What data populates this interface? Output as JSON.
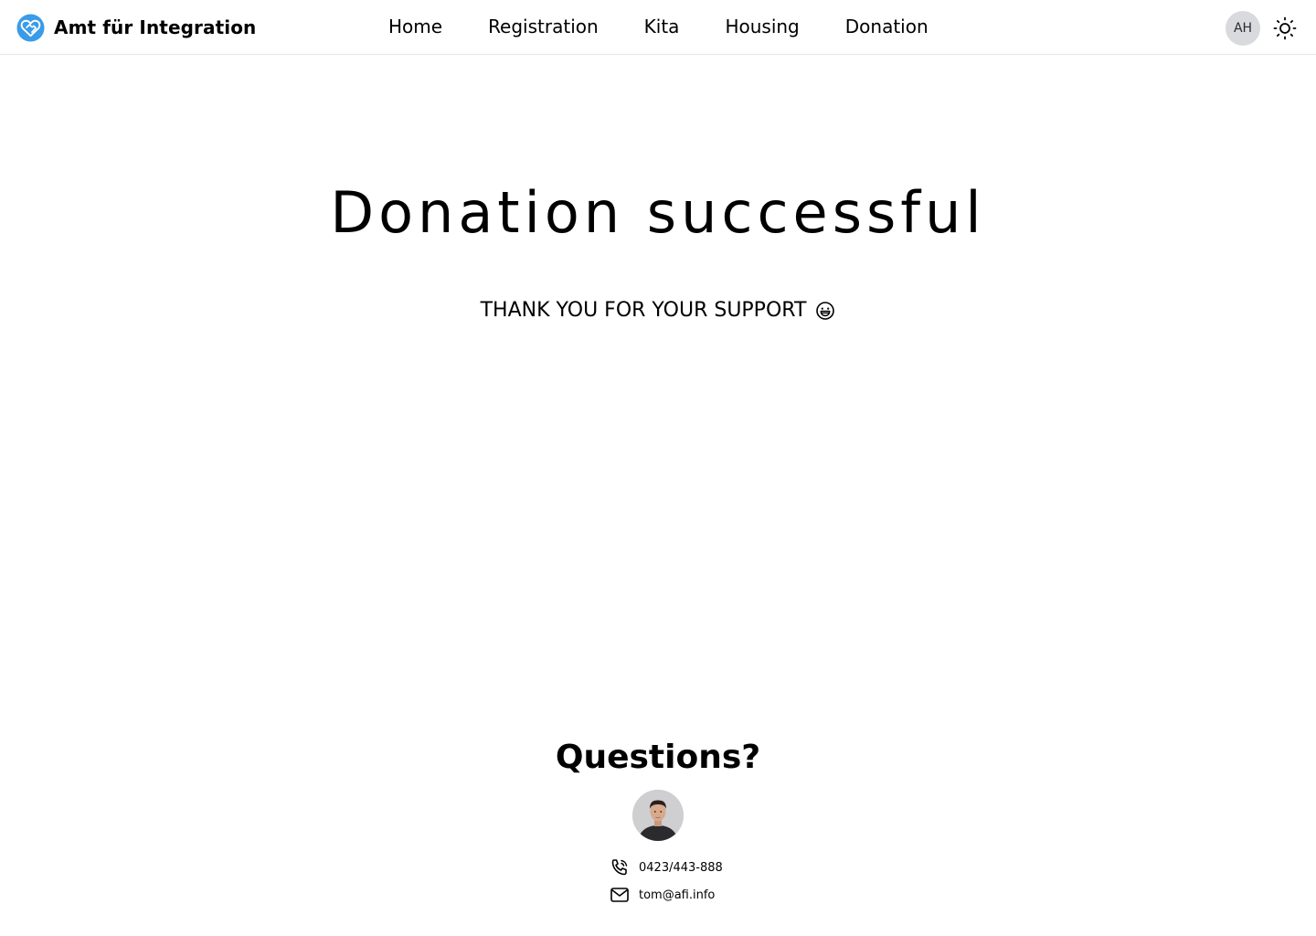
{
  "header": {
    "brand_name": "Amt für Integration",
    "logo_icon": "heart-handshake-icon",
    "nav": [
      {
        "label": "Home"
      },
      {
        "label": "Registration"
      },
      {
        "label": "Kita"
      },
      {
        "label": "Housing"
      },
      {
        "label": "Donation"
      }
    ],
    "avatar_initials": "AH",
    "theme_icon": "sun-icon"
  },
  "main": {
    "title": "Donation successful",
    "subtitle": "THANK YOU FOR YOUR SUPPORT",
    "subtitle_icon": "grinning-face-icon"
  },
  "contact": {
    "heading": "Questions?",
    "avatar_icon": "person-photo",
    "phone": "0423/443-888",
    "phone_icon": "phone-icon",
    "email": "tom@afi.info",
    "email_icon": "mail-icon"
  },
  "colors": {
    "accent": "#3a9be8",
    "text": "#000000",
    "avatar_bg": "#d9dadd",
    "divider": "#e6e6e6"
  }
}
